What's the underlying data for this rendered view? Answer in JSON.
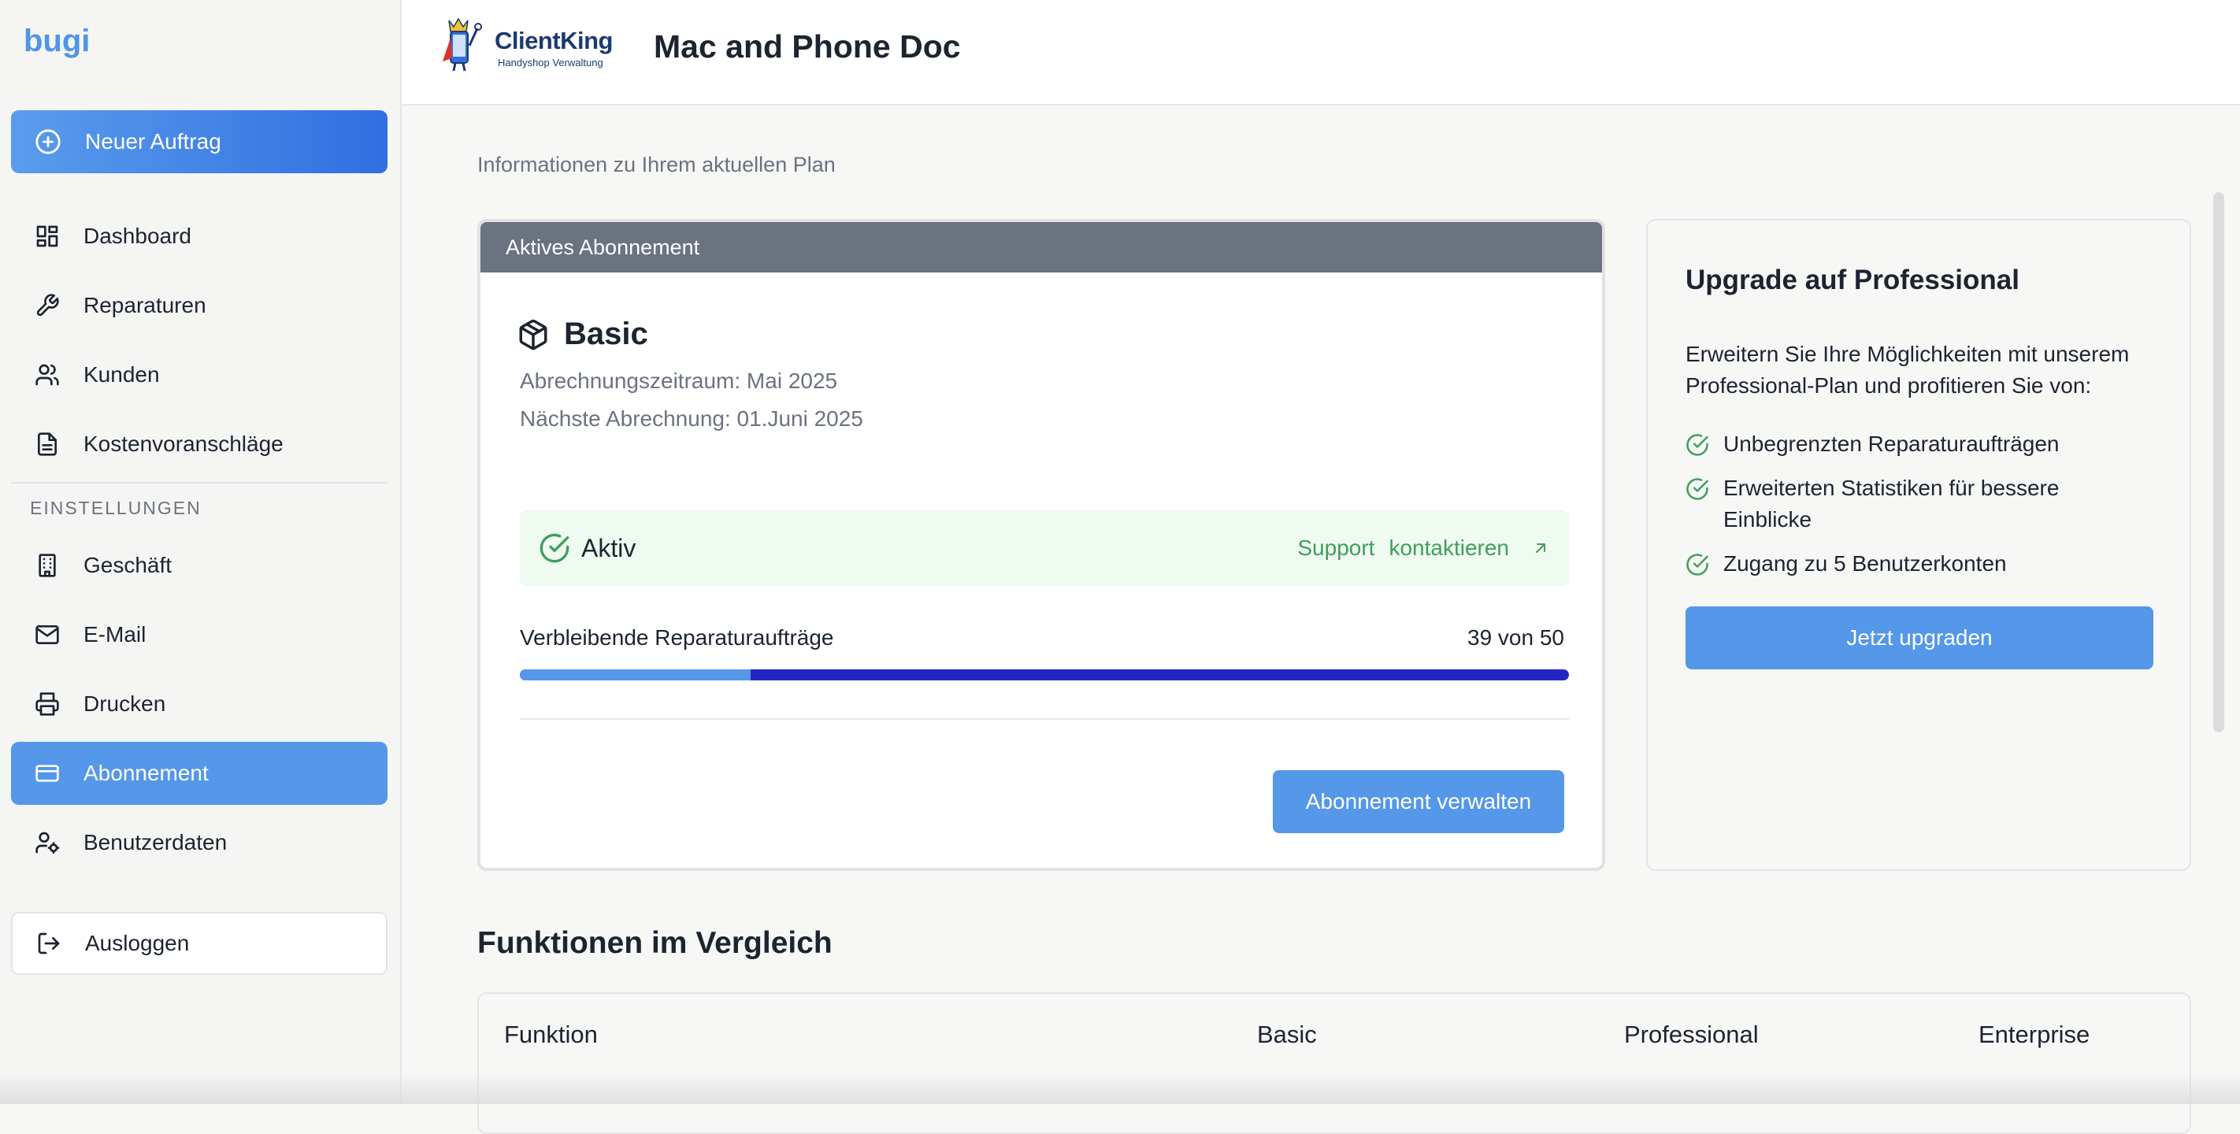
{
  "sidebar": {
    "brand": "bugi",
    "new_order": "Neuer Auftrag",
    "items": [
      {
        "label": "Dashboard"
      },
      {
        "label": "Reparaturen"
      },
      {
        "label": "Kunden"
      },
      {
        "label": "Kostenvoranschläge"
      }
    ],
    "settings_label": "EINSTELLUNGEN",
    "settings_items": [
      {
        "label": "Geschäft"
      },
      {
        "label": "E-Mail"
      },
      {
        "label": "Drucken"
      },
      {
        "label": "Abonnement"
      },
      {
        "label": "Benutzerdaten"
      }
    ],
    "logout": "Ausloggen"
  },
  "header": {
    "logo_name": "ClientKing",
    "logo_sub": "Handyshop Verwaltung",
    "title": "Mac and Phone Doc"
  },
  "main": {
    "info": "Informationen zu Ihrem aktuellen Plan",
    "active_card": {
      "header": "Aktives Abonnement",
      "plan": "Basic",
      "billing_period": "Abrechnungszeitraum: Mai 2025",
      "next_billing": "Nächste Abrechnung: 01.Juni 2025",
      "status": "Aktiv",
      "support_1": "Support",
      "support_2": "kontaktieren",
      "remaining_label": "Verbleibende Reparaturaufträge",
      "remaining_count": "39 von 50",
      "progress_used_fraction": 0.22,
      "manage_button": "Abonnement verwalten"
    },
    "upgrade_card": {
      "title": "Upgrade auf Professional",
      "description": "Erweitern Sie Ihre Möglichkeiten mit unserem Professional-Plan und profitieren Sie von:",
      "features": [
        "Unbegrenzten Reparaturaufträgen",
        "Erweiterten Statistiken für bessere Einblicke",
        "Zugang zu 5 Benutzerkonten"
      ],
      "button": "Jetzt upgraden"
    },
    "comparison": {
      "title": "Funktionen im Vergleich",
      "columns": [
        "Funktion",
        "Basic",
        "Professional",
        "Enterprise"
      ]
    }
  },
  "colors": {
    "accent": "#5597e8",
    "success": "#3ea05a",
    "progress_remaining": "#2426c4",
    "card_header": "#6b7280"
  }
}
